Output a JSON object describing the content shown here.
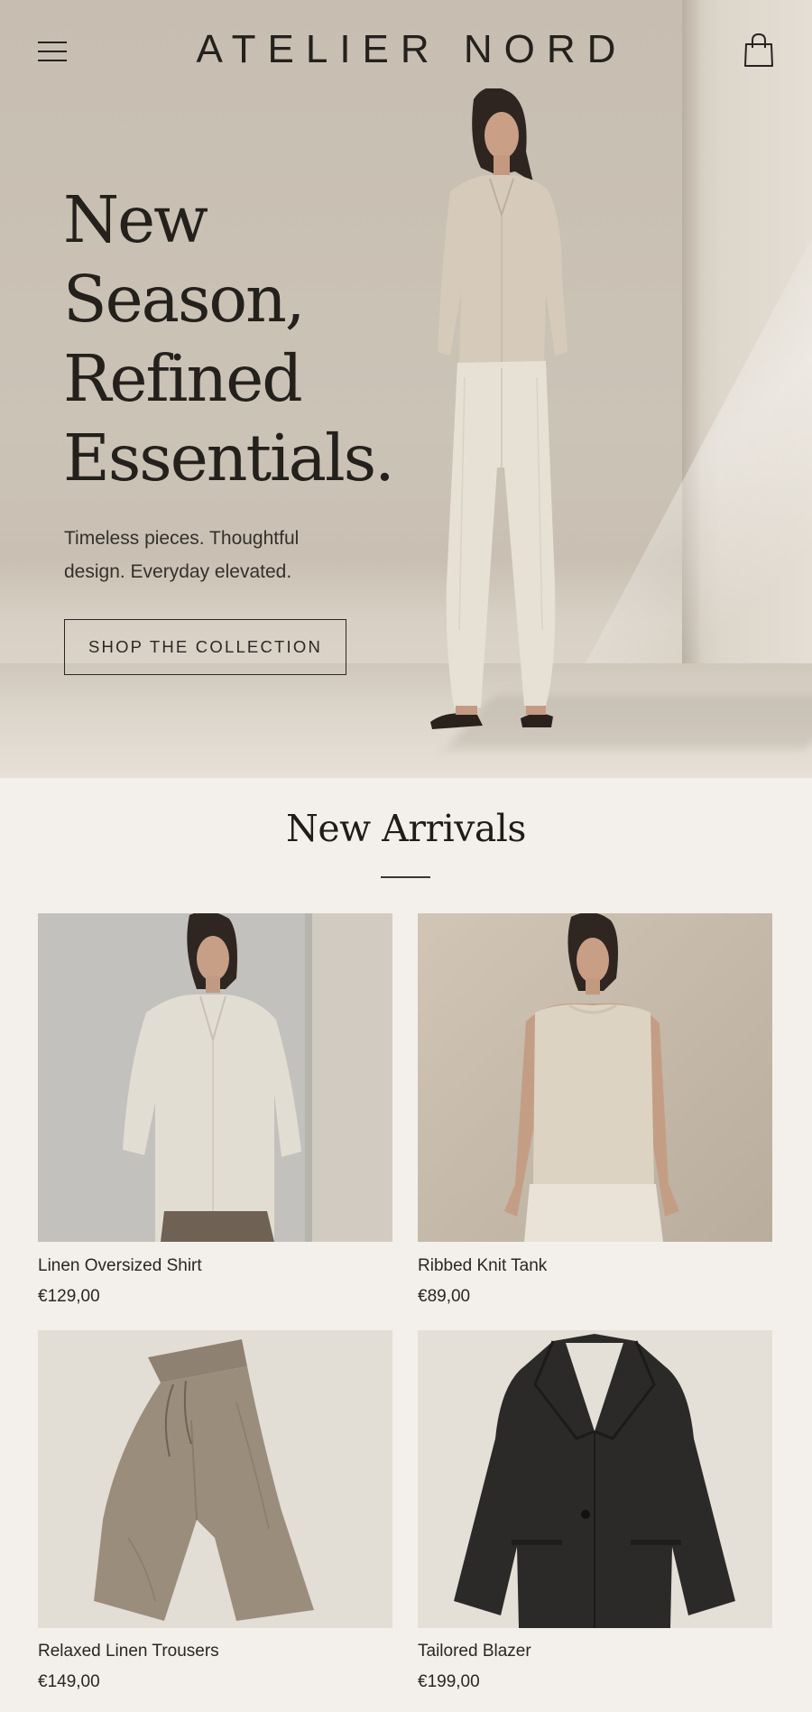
{
  "header": {
    "brand": "ATELIER NORD",
    "menu_icon": "hamburger-menu-icon",
    "cart_icon": "shopping-bag-icon"
  },
  "hero": {
    "title_lines": [
      "New",
      "Season,",
      "Refined",
      "Essentials."
    ],
    "subtitle": "Timeless pieces. Thoughtful design. Everyday elevated.",
    "cta_label": "SHOP THE COLLECTION"
  },
  "arrivals": {
    "title": "New Arrivals",
    "products": [
      {
        "name": "Linen Oversized Shirt",
        "price": "€129,00"
      },
      {
        "name": "Ribbed Knit Tank",
        "price": "€89,00"
      },
      {
        "name": "Relaxed Linen Trousers",
        "price": "€149,00"
      },
      {
        "name": "Tailored Blazer",
        "price": "€199,00"
      }
    ]
  },
  "colors": {
    "page_background": "#f3f0eb",
    "text": "#1e1c19",
    "hero_wall": "#c9c0b3"
  }
}
